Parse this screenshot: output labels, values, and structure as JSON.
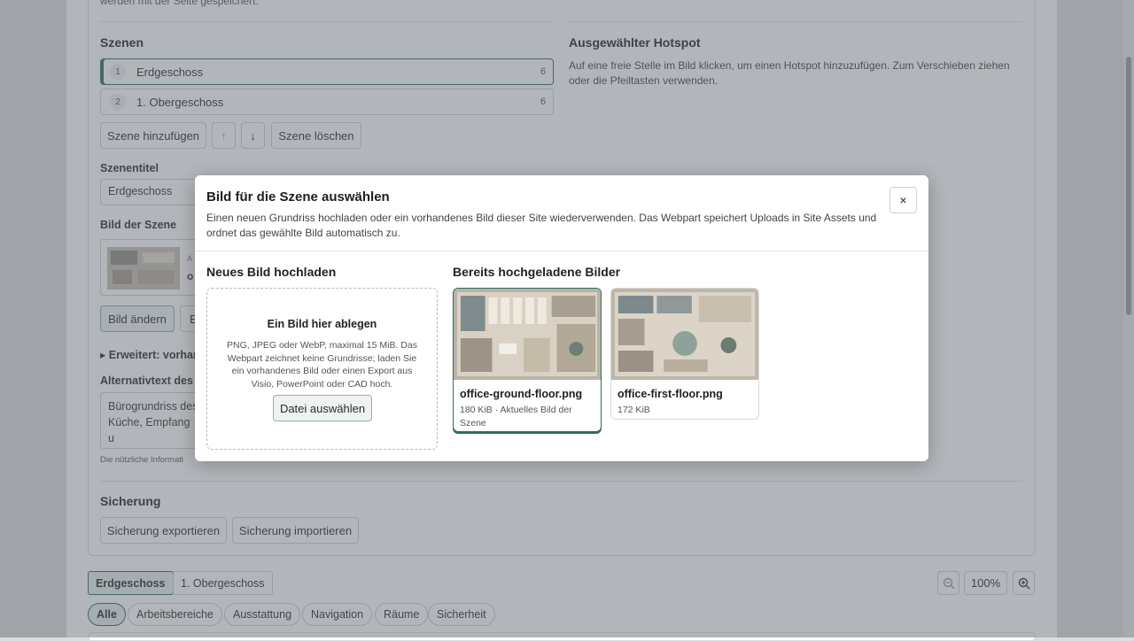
{
  "top_fragment": "werden mit der Seite gespeichert.",
  "scenes": {
    "heading": "Szenen",
    "items": [
      {
        "num": "1",
        "label": "Erdgeschoss",
        "count": "6"
      },
      {
        "num": "2",
        "label": "1. Obergeschoss",
        "count": "6"
      }
    ],
    "add_label": "Szene hinzufügen",
    "up_label": "↑",
    "down_label": "↓",
    "delete_label": "Szene löschen"
  },
  "scene_title": {
    "label": "Szenentitel",
    "value": "Erdgeschoss"
  },
  "scene_image": {
    "label": "Bild der Szene",
    "meta_fragment": "A",
    "name_fragment": "o",
    "change_label": "Bild ändern",
    "other_fragment": "E"
  },
  "advanced_label": "▸ Erweitert: vorhar",
  "alt_text": {
    "label": "Alternativtext des",
    "value_line1": "Bürogrundriss des",
    "value_line2": "Küche, Empfang u",
    "hint": "Die nützliche Informati"
  },
  "hotspot": {
    "heading": "Ausgewählter Hotspot",
    "help": "Auf eine freie Stelle im Bild klicken, um einen Hotspot hinzuzufügen. Zum Verschieben ziehen oder die Pfeiltasten verwenden."
  },
  "backup": {
    "heading": "Sicherung",
    "export_label": "Sicherung exportieren",
    "import_label": "Sicherung importieren"
  },
  "floor_tabs": [
    "Erdgeschoss",
    "1. Obergeschoss"
  ],
  "zoom": {
    "value": "100%",
    "out_icon": "zoom-out-icon",
    "in_icon": "zoom-in-icon"
  },
  "filters": [
    "Alle",
    "Arbeitsbereiche",
    "Ausstattung",
    "Navigation",
    "Räume",
    "Sicherheit"
  ],
  "modal": {
    "title": "Bild für die Szene auswählen",
    "description": "Einen neuen Grundriss hochladen oder ein vorhandenes Bild dieser Site wiederverwenden. Das Webpart speichert Uploads in Site Assets und ordnet das gewählte Bild automatisch zu.",
    "close_label": "×",
    "upload": {
      "heading": "Neues Bild hochladen",
      "drop_title": "Ein Bild hier ablegen",
      "drop_text": "PNG, JPEG oder WebP, maximal 15 MiB. Das Webpart zeichnet keine Grundrisse; laden Sie ein vorhandenes Bild oder einen Export aus Visio, PowerPoint oder CAD hoch.",
      "choose_label": "Datei auswählen"
    },
    "existing": {
      "heading": "Bereits hochgeladene Bilder",
      "images": [
        {
          "name": "office-ground-floor.png",
          "meta": "180 KiB · Aktuelles Bild der Szene"
        },
        {
          "name": "office-first-floor.png",
          "meta": "172 KiB"
        }
      ]
    }
  },
  "colors": {
    "accent": "#2c6e5f",
    "accent_soft": "#e5efec"
  }
}
